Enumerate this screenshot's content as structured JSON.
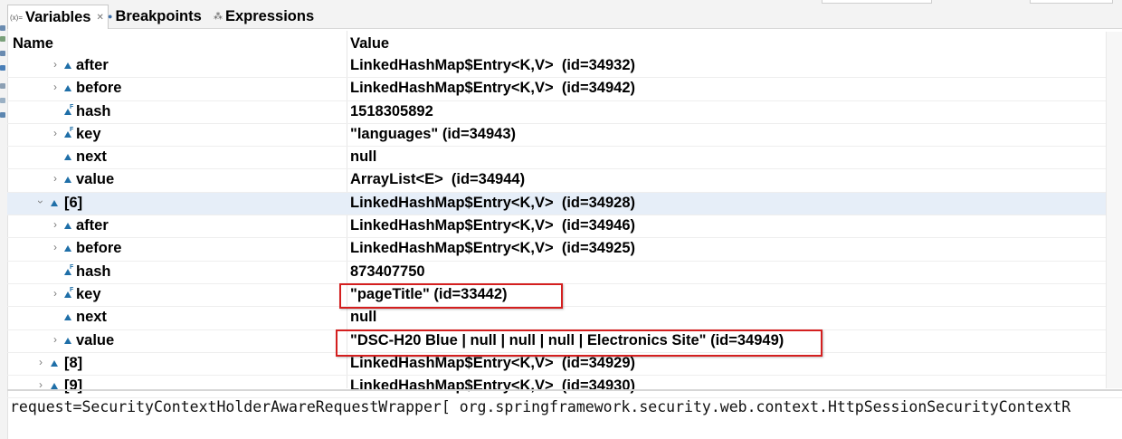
{
  "tabs": [
    {
      "label": "Variables",
      "icon": "variables-icon",
      "active": true
    },
    {
      "label": "Breakpoints",
      "icon": "breakpoints-icon",
      "active": false
    },
    {
      "label": "Expressions",
      "icon": "expressions-icon",
      "active": false
    }
  ],
  "columns": {
    "name": "Name",
    "value": "Value"
  },
  "rows": [
    {
      "name": "after",
      "value": "LinkedHashMap$Entry<K,V>  (id=34932)",
      "expandable": true,
      "final": false
    },
    {
      "name": "before",
      "value": "LinkedHashMap$Entry<K,V>  (id=34942)",
      "expandable": true,
      "final": false
    },
    {
      "name": "hash",
      "value": "1518305892",
      "expandable": false,
      "final": true
    },
    {
      "name": "key",
      "value": "\"languages\" (id=34943)",
      "expandable": true,
      "final": true
    },
    {
      "name": "next",
      "value": "null",
      "expandable": false,
      "final": false
    },
    {
      "name": "value",
      "value": "ArrayList<E>  (id=34944)",
      "expandable": true,
      "final": false
    },
    {
      "name": "[6]",
      "value": "LinkedHashMap$Entry<K,V>  (id=34928)",
      "expandable": true,
      "expanded": true,
      "selected": true
    },
    {
      "name": "after",
      "value": "LinkedHashMap$Entry<K,V>  (id=34946)",
      "expandable": true,
      "final": false
    },
    {
      "name": "before",
      "value": "LinkedHashMap$Entry<K,V>  (id=34925)",
      "expandable": true,
      "final": false
    },
    {
      "name": "hash",
      "value": "873407750",
      "expandable": false,
      "final": true
    },
    {
      "name": "key",
      "value": "\"pageTitle\" (id=33442)",
      "expandable": true,
      "final": true,
      "highlighted": true
    },
    {
      "name": "next",
      "value": "null",
      "expandable": false,
      "final": false
    },
    {
      "name": "value",
      "value": "\"DSC-H20 Blue | null | null | null | Electronics Site\" (id=34949)",
      "expandable": true,
      "final": false,
      "highlighted": true
    },
    {
      "name": "[8]",
      "value": "LinkedHashMap$Entry<K,V>  (id=34929)",
      "expandable": true
    },
    {
      "name": "[9]",
      "value": "LinkedHashMap$Entry<K,V>  (id=34930)",
      "expandable": true
    }
  ],
  "detail_text": "request=SecurityContextHolderAwareRequestWrapper[ org.springframework.security.web.context.HttpSessionSecurityContextR",
  "colors": {
    "highlight": "#d41f1f",
    "selection": "#e6eef8",
    "field_icon": "#1f6fa8"
  }
}
